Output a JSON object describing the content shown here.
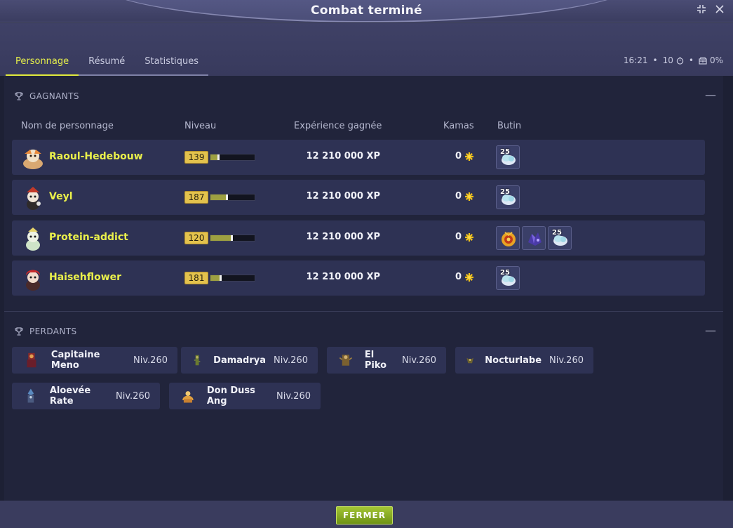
{
  "window": {
    "title": "Combat terminé",
    "shrink_icon": "shrink-icon",
    "close_icon": "close-icon"
  },
  "tabs": [
    {
      "label": "Personnage",
      "active": true
    },
    {
      "label": "Résumé",
      "active": false
    },
    {
      "label": "Statistiques",
      "active": false
    }
  ],
  "status": {
    "time": "16:21",
    "turns": "10",
    "turn_icon": "timer-icon",
    "chest_icon": "chest-icon",
    "percent": "0%"
  },
  "winners": {
    "heading": "GAGNANTS",
    "columns": {
      "name": "Nom de personnage",
      "level": "Niveau",
      "xp": "Expérience gagnée",
      "kamas": "Kamas",
      "loot": "Butin"
    },
    "rows": [
      {
        "name": "Raoul-Hedebouw",
        "level": "139",
        "xp_progress": 0.2,
        "xp": "12 210 000 XP",
        "kamas": "0",
        "loot": [
          {
            "icon": "essence-icon",
            "qty": "25"
          }
        ]
      },
      {
        "name": "Veyl",
        "level": "187",
        "xp_progress": 0.4,
        "xp": "12 210 000 XP",
        "kamas": "0",
        "loot": [
          {
            "icon": "essence-icon",
            "qty": "25"
          }
        ]
      },
      {
        "name": "Protein-addict",
        "level": "120",
        "xp_progress": 0.5,
        "xp": "12 210 000 XP",
        "kamas": "0",
        "loot": [
          {
            "icon": "amulet-icon",
            "qty": ""
          },
          {
            "icon": "dark-stone-icon",
            "qty": ""
          },
          {
            "icon": "essence-icon",
            "qty": "25"
          }
        ]
      },
      {
        "name": "Haisehflower",
        "level": "181",
        "xp_progress": 0.25,
        "xp": "12 210 000 XP",
        "kamas": "0",
        "loot": [
          {
            "icon": "essence-icon",
            "qty": "25"
          }
        ]
      }
    ]
  },
  "losers": {
    "heading": "PERDANTS",
    "items": [
      {
        "name": "Capitaine Meno",
        "level": "Niv.260"
      },
      {
        "name": "Damadrya",
        "level": "Niv.260"
      },
      {
        "name": "El Piko",
        "level": "Niv.260"
      },
      {
        "name": "Nocturlabe",
        "level": "Niv.260"
      },
      {
        "name": "Aloevée Rate",
        "level": "Niv.260"
      },
      {
        "name": "Don Duss Ang",
        "level": "Niv.260"
      }
    ]
  },
  "footer": {
    "close_label": "FERMER"
  },
  "colors": {
    "accent_yellow": "#e6ef4a",
    "row_bg": "#2e3254",
    "button_green": "#8fb226"
  }
}
